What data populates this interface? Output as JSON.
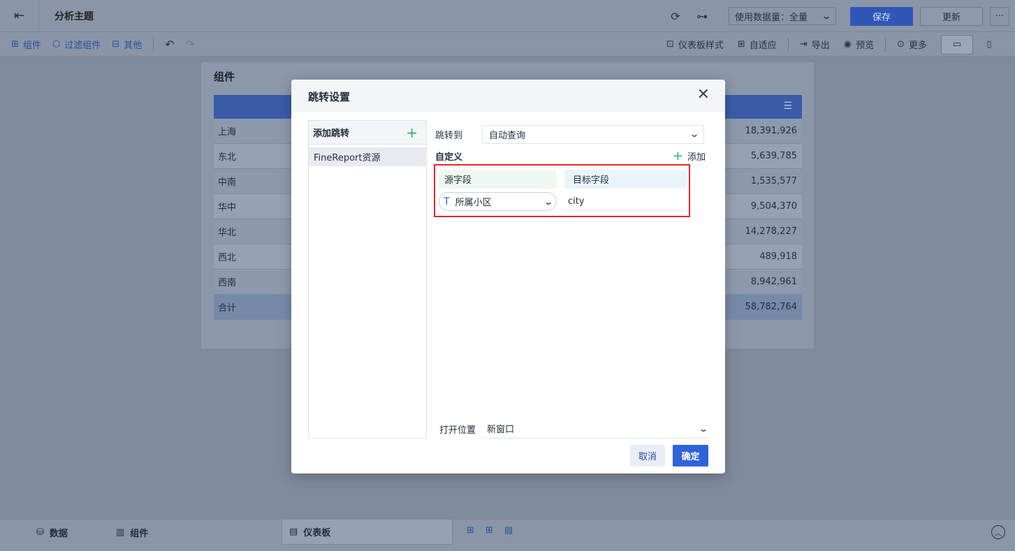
{
  "app": {
    "title": "分析主题",
    "data_usage_label": "使用数据量：全量",
    "save_label": "保存",
    "update_label": "更新",
    "more_label": "···"
  },
  "toolbar": {
    "component_label": "组件",
    "filter_label": "过滤组件",
    "other_label": "其他",
    "dashboard_style_label": "仪表板样式",
    "adapt_label": "自适应",
    "export_label": "导出",
    "preview_label": "预览",
    "more_label": "更多"
  },
  "panel": {
    "title": "组件",
    "rows": [
      {
        "name": "上海",
        "value": "18,391,926"
      },
      {
        "name": "东北",
        "value": "5,639,785"
      },
      {
        "name": "中南",
        "value": "1,535,577"
      },
      {
        "name": "华中",
        "value": "9,504,370"
      },
      {
        "name": "华北",
        "value": "14,278,227"
      },
      {
        "name": "西北",
        "value": "489,918"
      },
      {
        "name": "西南",
        "value": "8,942,961"
      }
    ],
    "total": {
      "name": "合计",
      "value": "58,782,764"
    }
  },
  "bottom": {
    "data_label": "数据",
    "component_label": "组件",
    "dashboard_label": "仪表板"
  },
  "dialog": {
    "title": "跳转设置",
    "add_jump_label": "添加跳转",
    "jump_items": [
      "FineReport资源"
    ],
    "jump_to_label": "跳转到",
    "jump_to_value": "自动查询",
    "custom_label": "自定义",
    "add_label": "添加",
    "source_field_header": "源字段",
    "target_field_header": "目标字段",
    "source_field_value": "所属小区",
    "target_field_value": "city",
    "open_position_label": "打开位置",
    "open_position_value": "新窗口",
    "cancel_label": "取消",
    "ok_label": "确定"
  },
  "colors": {
    "accent": "#2e63d9",
    "highlight_border": "#e0262c",
    "add_green": "#2db55d"
  }
}
